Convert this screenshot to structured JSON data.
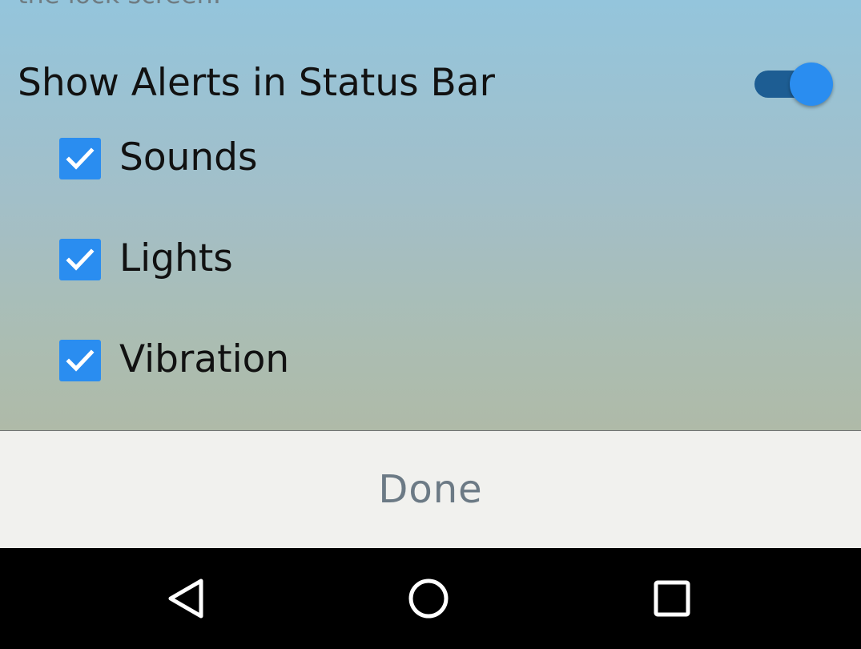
{
  "settings": {
    "partial_text_top": "the lock screen.",
    "status_bar": {
      "label": "Show Alerts in Status Bar",
      "enabled": true
    },
    "options": [
      {
        "label": "Sounds",
        "checked": true
      },
      {
        "label": "Lights",
        "checked": true
      },
      {
        "label": "Vibration",
        "checked": true
      }
    ]
  },
  "footer": {
    "done_label": "Done"
  },
  "navbar": {
    "icons": [
      "back-icon",
      "home-icon",
      "recent-apps-icon"
    ]
  },
  "colors": {
    "accent": "#2a8df0",
    "toggle_track": "#1d5d93",
    "done_text": "#6c7a85",
    "footer_bg": "#f1f1ee",
    "navbar_bg": "#000000"
  }
}
